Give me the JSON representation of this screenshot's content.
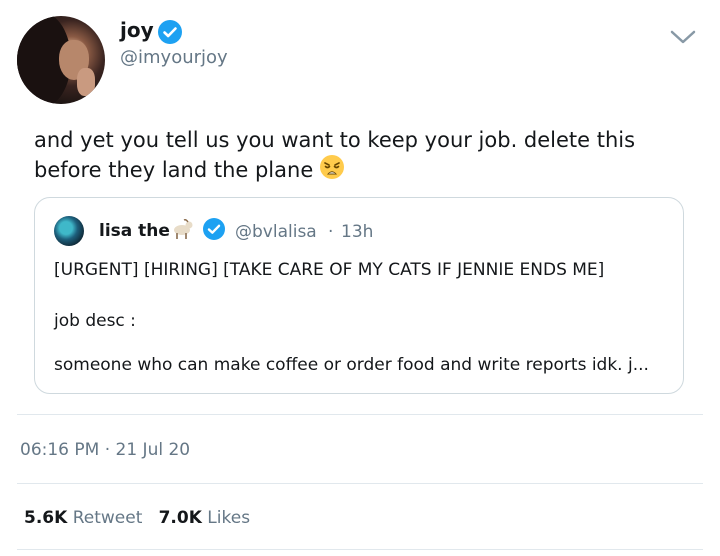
{
  "tweet": {
    "author_name": "joy",
    "author_handle": "@imyourjoy",
    "text_line1": "and yet you tell us you want to keep your job. delete this",
    "text_line2": "before they land the plane",
    "text_emoji": "weary-face-emoji",
    "timestamp": "06:16 PM · 21 Jul 20"
  },
  "quoted_tweet": {
    "author_name": "lisa the",
    "name_emoji": "goat-emoji",
    "author_handle": "@bvlalisa",
    "separator": "·",
    "time_ago": "13h",
    "line1": "[URGENT] [HIRING] [TAKE CARE OF MY CATS IF JENNIE ENDS ME]",
    "line2": "job desc :",
    "line3": "someone who can make coffee or order food and write reports idk. j..."
  },
  "stats": {
    "retweets_count": "5.6K",
    "retweets_label": "Retweet",
    "likes_count": "7.0K",
    "likes_label": "Likes"
  },
  "colors": {
    "verified_blue": "#1da1f2",
    "muted_text": "#657786",
    "primary_text": "#14171a",
    "border": "#cfd9de"
  }
}
